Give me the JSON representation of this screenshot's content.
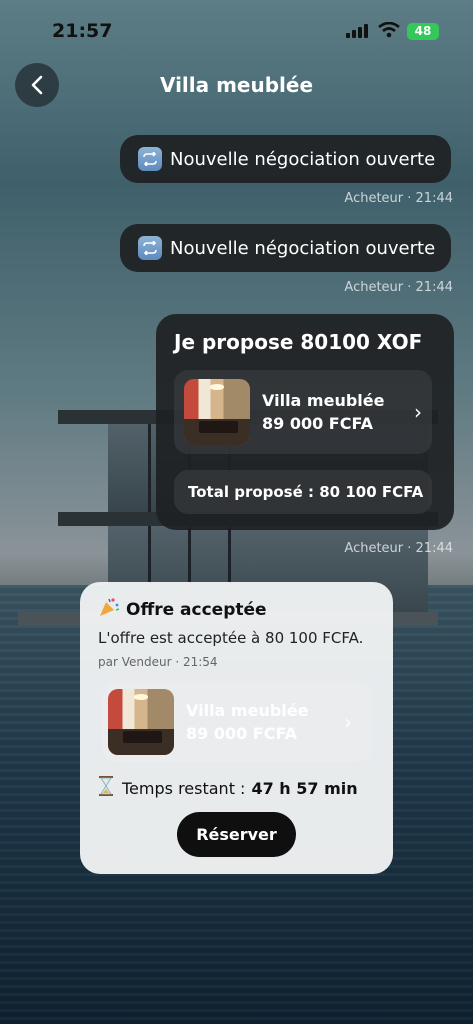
{
  "status_bar": {
    "time": "21:57",
    "battery": "48"
  },
  "header": {
    "title": "Villa meublée"
  },
  "messages": [
    {
      "text": "Nouvelle négociation ouverte",
      "meta": "Acheteur · 21:44"
    },
    {
      "text": "Nouvelle négociation ouverte",
      "meta": "Acheteur · 21:44"
    }
  ],
  "offer": {
    "title": "Je propose 80100 XOF",
    "product_name": "Villa meublée",
    "product_price": "89 000 FCFA",
    "total": "Total proposé : 80 100 FCFA",
    "meta": "Acheteur · 21:44"
  },
  "accepted": {
    "title": "Offre acceptée",
    "message": "L'offre est acceptée à 80 100 FCFA.",
    "meta": "par Vendeur · 21:54",
    "product_name": "Villa meublée",
    "product_price": "89 000 FCFA",
    "timer_label": "Temps restant :",
    "timer_value": "47 h 57 min",
    "button": "Réserver"
  },
  "icons": {
    "back": "chevron-left-icon",
    "swap": "repeat-icon",
    "party": "party-popper-icon",
    "hourglass": "hourglass-icon"
  }
}
